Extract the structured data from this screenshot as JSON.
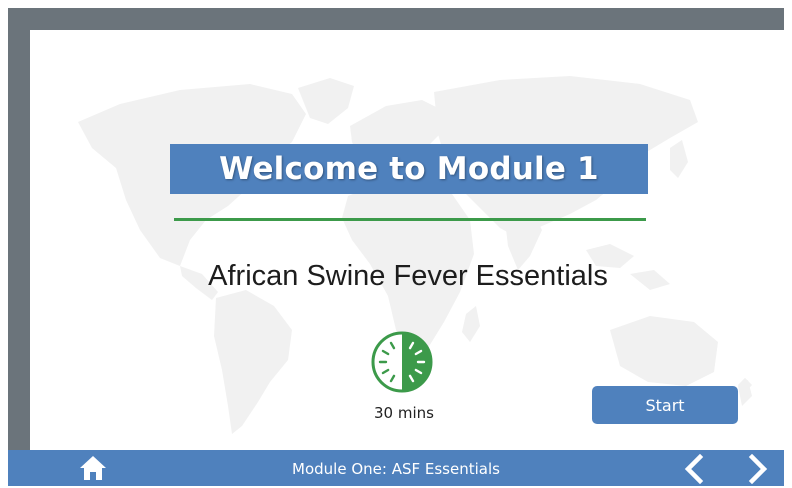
{
  "slide": {
    "title": "Welcome to Module 1",
    "subtitle": "African Swine Fever Essentials",
    "duration": "30 mins",
    "start_label": "Start"
  },
  "footer": {
    "title": "Module One: ASF Essentials"
  },
  "icons": {
    "home": "home-icon",
    "prev": "chevron-left-icon",
    "next": "chevron-right-icon",
    "timer": "timer-icon",
    "background": "world-map-icon"
  },
  "colors": {
    "frame": "#6b747b",
    "accent_blue": "#4f81bd",
    "divider_green": "#3c9a4a",
    "timer_green": "#3c9a4a",
    "map_gray": "#f1f1f1"
  }
}
